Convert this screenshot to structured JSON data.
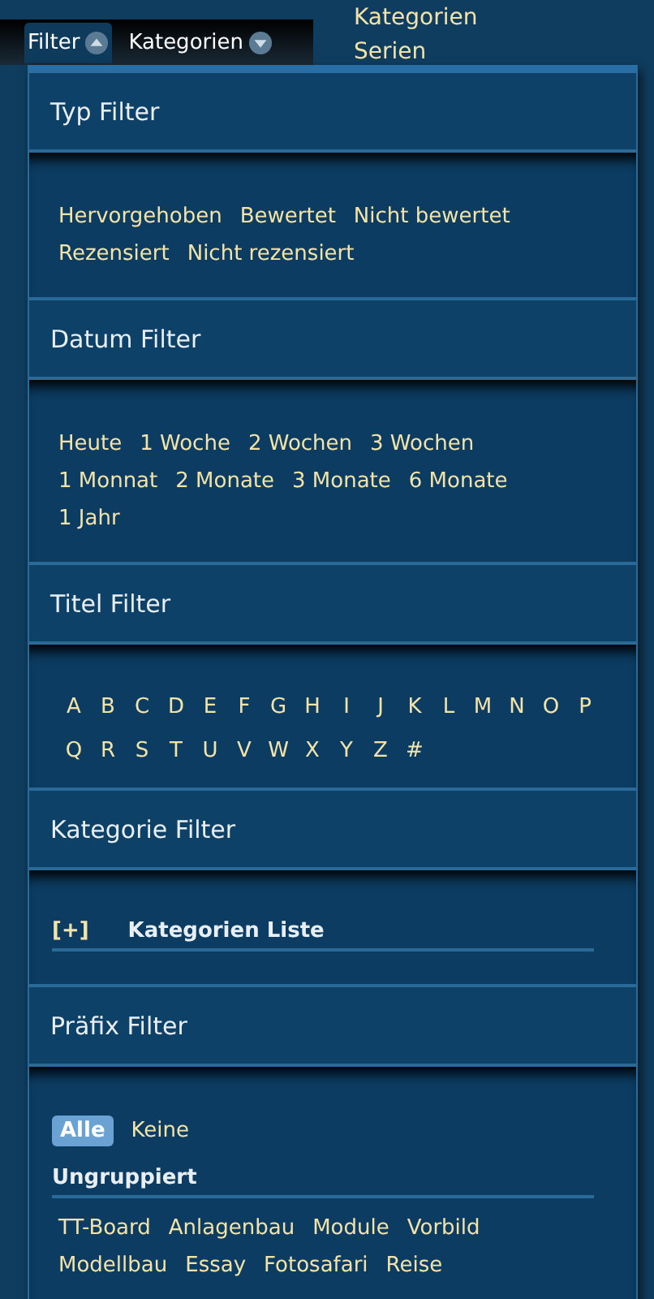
{
  "topbar": {
    "tabs": [
      {
        "label": "Filter",
        "expanded": true
      },
      {
        "label": "Kategorien",
        "expanded": false
      }
    ]
  },
  "sidebar": {
    "links": [
      "Kategorien",
      "Serien"
    ]
  },
  "filter_popup": {
    "sections": [
      {
        "kind": "options",
        "title": "Typ Filter",
        "options": [
          "Hervorgehoben",
          "Bewertet",
          "Nicht bewertet",
          "Rezensiert",
          "Nicht rezensiert"
        ]
      },
      {
        "kind": "options",
        "title": "Datum Filter",
        "options": [
          "Heute",
          "1 Woche",
          "2 Wochen",
          "3 Wochen",
          "1 Monnat",
          "2 Monate",
          "3 Monate",
          "6 Monate",
          "1 Jahr"
        ]
      },
      {
        "kind": "letters",
        "title": "Titel Filter",
        "options": [
          "A",
          "B",
          "C",
          "D",
          "E",
          "F",
          "G",
          "H",
          "I",
          "J",
          "K",
          "L",
          "M",
          "N",
          "O",
          "P",
          "Q",
          "R",
          "S",
          "T",
          "U",
          "V",
          "W",
          "X",
          "Y",
          "Z",
          "#"
        ]
      },
      {
        "kind": "tree",
        "title": "Kategorie Filter",
        "toggle": "[+]",
        "label": "Kategorien Liste"
      },
      {
        "kind": "prefix",
        "title": "Präfix Filter",
        "choices": [
          {
            "label": "Alle",
            "selected": true
          },
          {
            "label": "Keine",
            "selected": false
          }
        ],
        "group": "Ungruppiert",
        "options": [
          "TT-Board",
          "Anlagenbau",
          "Module",
          "Vorbild",
          "Modellbau",
          "Essay",
          "Fotosafari",
          "Reise"
        ]
      }
    ]
  }
}
